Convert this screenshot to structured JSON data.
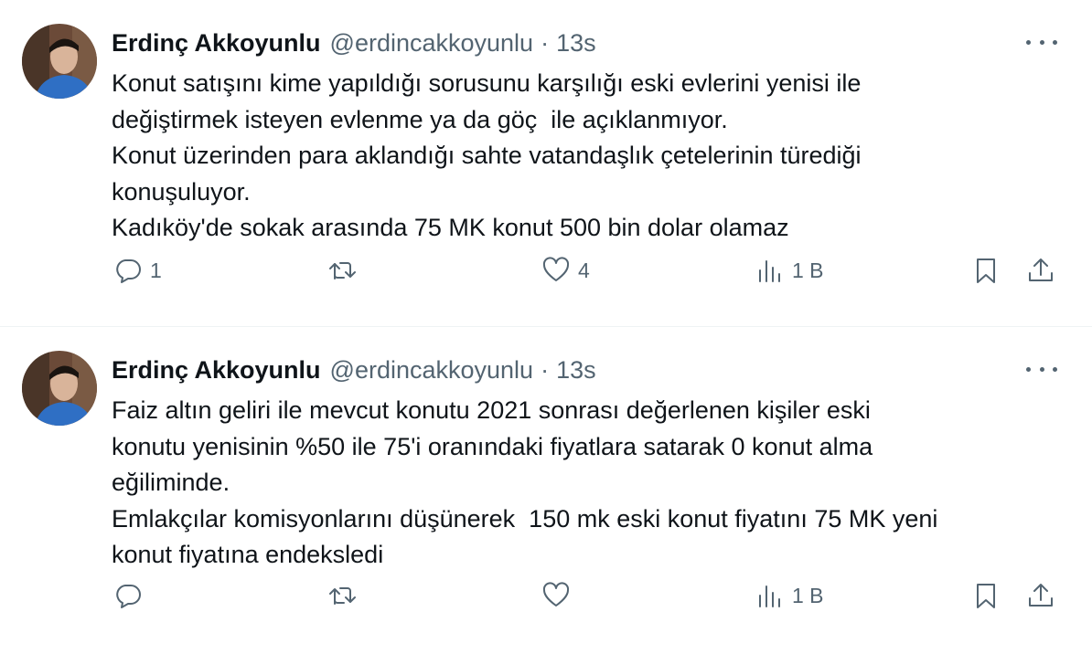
{
  "tweets": [
    {
      "author_name": "Erdinç Akkoyunlu",
      "author_handle": "@erdincakkoyunlu",
      "separator": "·",
      "time": "13s",
      "lines": [
        "Konut satışını kime yapıldığı sorusunu karşılığı eski evlerini yenisi ile",
        "değiştirmek isteyen evlenme ya da göç  ile açıklanmıyor.",
        "Konut üzerinden para aklandığı sahte vatandaşlık çetelerinin türediği",
        "konuşuluyor.",
        "Kadıköy'de sokak arasında 75 MK konut 500 bin dolar olamaz"
      ],
      "reply_count": "1",
      "retweet_count": "",
      "like_count": "4",
      "view_count": "1 B"
    },
    {
      "author_name": "Erdinç Akkoyunlu",
      "author_handle": "@erdincakkoyunlu",
      "separator": "·",
      "time": "13s",
      "lines": [
        "Faiz altın geliri ile mevcut konutu 2021 sonrası değerlenen kişiler eski",
        "konutu yenisinin %50 ile 75'i oranındaki fiyatlara satarak 0 konut alma",
        "eğiliminde.",
        "Emlakçılar komisyonlarını düşünerek  150 mk eski konut fiyatını 75 MK yeni",
        "konut fiyatına endeksledi"
      ],
      "reply_count": "",
      "retweet_count": "",
      "like_count": "",
      "view_count": "1 B"
    }
  ],
  "icons": {
    "more": "more-horizontal-icon",
    "reply": "reply-icon",
    "retweet": "retweet-icon",
    "like": "heart-icon",
    "views": "views-bar-chart-icon",
    "bookmark": "bookmark-icon",
    "share": "share-upload-icon"
  },
  "colors": {
    "text": "#0f1419",
    "secondary": "#536471",
    "divider": "#eff3f4"
  }
}
